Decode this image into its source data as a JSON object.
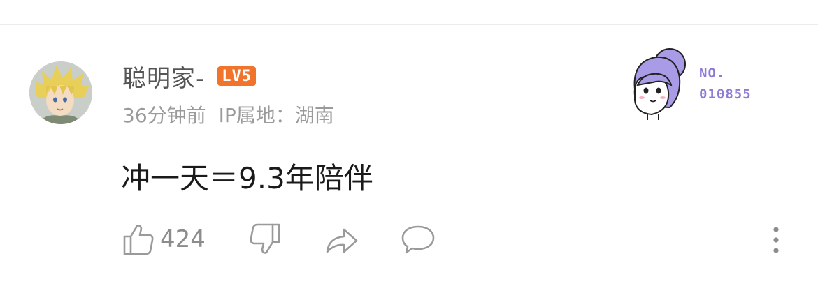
{
  "comment": {
    "author": "聪明家-",
    "level_badge": "LV5",
    "time_ago": "36分钟前",
    "ip_location": "IP属地：湖南",
    "text": "冲一天＝9.3年陪伴",
    "like_count": "424"
  },
  "decoration": {
    "label_no": "NO.",
    "label_number": "010855"
  },
  "icons": {
    "like": "thumbs-up-icon",
    "dislike": "thumbs-down-icon",
    "share": "share-arrow-icon",
    "reply": "comment-bubble-icon",
    "more": "more-vertical-icon"
  },
  "colors": {
    "level_badge": "#f0742b",
    "decoration_accent": "#8f7bd6"
  }
}
